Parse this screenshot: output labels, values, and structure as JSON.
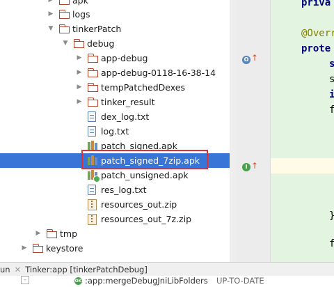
{
  "tree": {
    "items": [
      {
        "label": "apk",
        "kind": "folder",
        "arrow": "right",
        "indent": 1
      },
      {
        "label": "logs",
        "kind": "folder",
        "arrow": "right",
        "indent": 1
      },
      {
        "label": "tinkerPatch",
        "kind": "folder",
        "arrow": "down",
        "indent": 1
      },
      {
        "label": "debug",
        "kind": "folder",
        "arrow": "down",
        "indent": 2
      },
      {
        "label": "app-debug",
        "kind": "folder",
        "arrow": "right",
        "indent": 3
      },
      {
        "label": "app-debug-0118-16-38-14",
        "kind": "folder",
        "arrow": "right",
        "indent": 3
      },
      {
        "label": "tempPatchedDexes",
        "kind": "folder",
        "arrow": "right",
        "indent": 3
      },
      {
        "label": "tinker_result",
        "kind": "folder",
        "arrow": "right",
        "indent": 3
      },
      {
        "label": "dex_log.txt",
        "kind": "text-file",
        "arrow": "none",
        "indent": 3
      },
      {
        "label": "log.txt",
        "kind": "text-file",
        "arrow": "none",
        "indent": 3
      },
      {
        "label": "patch_signed.apk",
        "kind": "apk",
        "arrow": "none",
        "indent": 3
      },
      {
        "label": "patch_signed_7zip.apk",
        "kind": "apk",
        "arrow": "none",
        "indent": 3,
        "selected": true
      },
      {
        "label": "patch_unsigned.apk",
        "kind": "apk",
        "arrow": "none",
        "indent": 3
      },
      {
        "label": "res_log.txt",
        "kind": "text-file",
        "arrow": "none",
        "indent": 3
      },
      {
        "label": "resources_out.zip",
        "kind": "zip",
        "arrow": "none",
        "indent": 3
      },
      {
        "label": "resources_out_7z.zip",
        "kind": "zip",
        "arrow": "none",
        "indent": 3
      },
      {
        "label": "tmp",
        "kind": "folder",
        "arrow": "right",
        "indent": 0.5
      },
      {
        "label": "keystore",
        "kind": "folder",
        "arrow": "right",
        "indent": 0
      }
    ]
  },
  "editor": {
    "lines": [
      {
        "text": "priva",
        "style": "kw"
      },
      {
        "text": "",
        "style": ""
      },
      {
        "text": "@Overr",
        "style": "ann"
      },
      {
        "text": "prote",
        "style": "kw"
      },
      {
        "text": "s",
        "style": "kw"
      },
      {
        "text": "s",
        "style": ""
      },
      {
        "text": "i",
        "style": "kw"
      },
      {
        "text": "f",
        "style": ""
      },
      {
        "text": "",
        "style": ""
      },
      {
        "text": "",
        "style": ""
      },
      {
        "text": "",
        "style": ""
      },
      {
        "text": "",
        "style": ""
      },
      {
        "text": "",
        "style": ""
      },
      {
        "text": "",
        "style": ""
      },
      {
        "text": "}",
        "style": ""
      },
      {
        "text": "",
        "style": ""
      },
      {
        "text": "",
        "style": ""
      },
      {
        "text": "f",
        "style": ""
      }
    ],
    "gutter_icons": [
      {
        "name": "override-icon",
        "letter": "O",
        "color": "#5a86b8"
      },
      {
        "name": "implementation-icon",
        "letter": "I",
        "color": "#4a9f4a"
      }
    ]
  },
  "status": {
    "run_label": "un",
    "task_label": "Tinker:app [tinkerPatchDebug]"
  },
  "console": {
    "ok_badge": "OK",
    "task": ":app:mergeDebugJniLibFolders",
    "state": "UP-TO-DATE"
  },
  "colors": {
    "selection": "#3875d7",
    "highlight_box": "#e0302f",
    "editor_bg": "#e3f4e0"
  }
}
